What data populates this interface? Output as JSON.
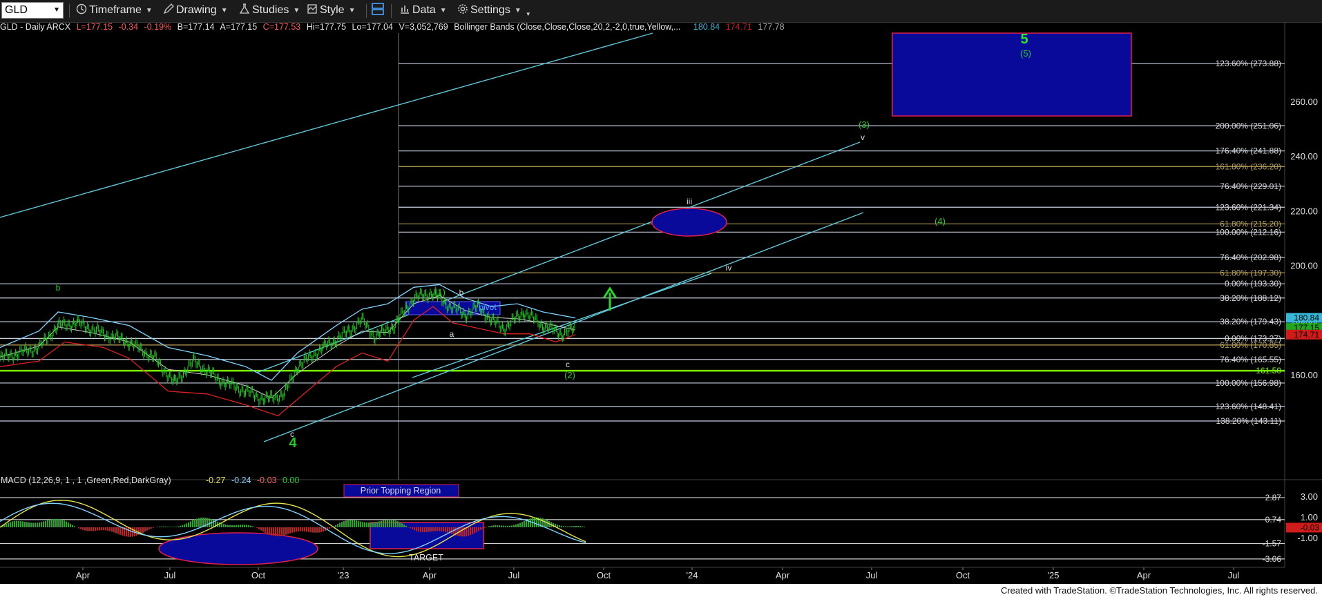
{
  "toolbar": {
    "symbol": "GLD",
    "timeframe_label": "Timeframe",
    "drawing_label": "Drawing",
    "studies_label": "Studies",
    "style_label": "Style",
    "data_label": "Data",
    "settings_label": "Settings"
  },
  "info": {
    "title": "GLD - Daily ARCX",
    "last": "L=177.15",
    "change": "-0.34",
    "pct": "-0.19%",
    "bid": "B=177.14",
    "ask": "A=177.15",
    "close": "C=177.53",
    "high": "Hi=177.75",
    "low": "Lo=177.04",
    "volume": "V=3,052,769",
    "study": "Bollinger Bands (Close,Close,Close,20,2,-2,0,true,Yellow,...",
    "bb_upper": "180.84",
    "bb_lower": "174.71",
    "bb_mid": "177.78"
  },
  "colors": {
    "price_bars": "#22cc22",
    "bb_upper": "#7fd3ff",
    "bb_lower": "#e02020",
    "bb_mid": "#cfcfcf",
    "trendline": "#5fc8d8",
    "fib_line": "#c8d0e0",
    "green_support": "#7cfc00",
    "box_blue": "#0a0a9a",
    "box_border": "#e0204a"
  },
  "chart_data": [
    {
      "type": "line",
      "title": "GLD - Daily ARCX",
      "ylim": [
        133,
        285
      ],
      "y_ticks": [
        160,
        180,
        200,
        220,
        240,
        260
      ],
      "x_labels": [
        "Apr",
        "Jul",
        "Oct",
        "'23",
        "Apr",
        "Jul",
        "Oct",
        "'24",
        "Apr",
        "Jul",
        "Oct",
        "'25",
        "Apr",
        "Jul"
      ],
      "right_price_tags": [
        {
          "value": 180.84,
          "label": "180.84",
          "color": "#39b7d6"
        },
        {
          "value": 177.15,
          "label": "177.15",
          "color": "#1fa81f"
        },
        {
          "value": 174.71,
          "label": "174.71",
          "color": "#d01b1b"
        }
      ],
      "series": [
        {
          "values_desc": "daily close",
          "points": [
            [
              0,
              166
            ],
            [
              0.03,
              170
            ],
            [
              0.045,
              178
            ],
            [
              0.06,
              179
            ],
            [
              0.08,
              175
            ],
            [
              0.1,
              172
            ],
            [
              0.12,
              166
            ],
            [
              0.135,
              157
            ],
            [
              0.15,
              165
            ],
            [
              0.17,
              158
            ],
            [
              0.19,
              154
            ],
            [
              0.205,
              151
            ],
            [
              0.22,
              153
            ],
            [
              0.23,
              163
            ],
            [
              0.25,
              170
            ],
            [
              0.27,
              176
            ],
            [
              0.28,
              180
            ],
            [
              0.29,
              174
            ],
            [
              0.305,
              178
            ],
            [
              0.32,
              188
            ],
            [
              0.335,
              190
            ],
            [
              0.345,
              186
            ],
            [
              0.36,
              182
            ],
            [
              0.37,
              185
            ],
            [
              0.38,
              180
            ],
            [
              0.39,
              177
            ],
            [
              0.405,
              183
            ],
            [
              0.42,
              178
            ],
            [
              0.435,
              175
            ],
            [
              0.445,
              177
            ]
          ]
        },
        {
          "name": "",
          "values_desc": "bb upper",
          "points": [
            [
              0,
              170
            ],
            [
              0.03,
              176
            ],
            [
              0.045,
              183
            ],
            [
              0.07,
              181
            ],
            [
              0.1,
              178
            ],
            [
              0.13,
              170
            ],
            [
              0.16,
              167
            ],
            [
              0.19,
              163
            ],
            [
              0.21,
              158
            ],
            [
              0.23,
              168
            ],
            [
              0.26,
              178
            ],
            [
              0.28,
              184
            ],
            [
              0.3,
              186
            ],
            [
              0.32,
              192
            ],
            [
              0.34,
              193
            ],
            [
              0.36,
              188
            ],
            [
              0.38,
              185
            ],
            [
              0.4,
              186
            ],
            [
              0.42,
              183
            ],
            [
              0.445,
              180.8
            ]
          ]
        },
        {
          "name": "",
          "values_desc": "bb lower",
          "points": [
            [
              0,
              163
            ],
            [
              0.03,
              165
            ],
            [
              0.05,
              172
            ],
            [
              0.08,
              170
            ],
            [
              0.1,
              166
            ],
            [
              0.13,
              154
            ],
            [
              0.16,
              153
            ],
            [
              0.19,
              149
            ],
            [
              0.215,
              145
            ],
            [
              0.235,
              153
            ],
            [
              0.26,
              163
            ],
            [
              0.28,
              168
            ],
            [
              0.3,
              165
            ],
            [
              0.32,
              180
            ],
            [
              0.335,
              185
            ],
            [
              0.35,
              179
            ],
            [
              0.37,
              177
            ],
            [
              0.39,
              175
            ],
            [
              0.41,
              175
            ],
            [
              0.43,
              172
            ],
            [
              0.445,
              174.7
            ]
          ]
        }
      ],
      "horizontal_levels": [
        {
          "label": "123.60% (273.88)",
          "value": 273.9
        },
        {
          "label": "200.00% (251.06)",
          "value": 251.1
        },
        {
          "label": "176.40% (241.88)",
          "value": 241.9
        },
        {
          "label": "161.80% (236.20)",
          "value": 236.2
        },
        {
          "label": "76.40% (229.01)",
          "value": 229.0
        },
        {
          "label": "123.60% (221.34)",
          "value": 221.3
        },
        {
          "label": "61.80% (215.20)",
          "value": 215.2
        },
        {
          "label": "100.00% (212.16)",
          "value": 212.2
        },
        {
          "label": "76.40% (202.98)",
          "value": 203.0
        },
        {
          "label": "61.80% (197.30)",
          "value": 197.3
        },
        {
          "label": "0.00% (193.30)",
          "value": 193.3
        },
        {
          "label": "38.20% (188.12)",
          "value": 188.1
        },
        {
          "label": "38.20% (179.43)",
          "value": 179.4
        },
        {
          "label": "0.00% (173.27)",
          "value": 173.3
        },
        {
          "label": "61.80% (170.85)",
          "value": 170.9
        },
        {
          "label": "76.40% (165.55)",
          "value": 165.6
        },
        {
          "label": "161.50",
          "value": 161.5
        },
        {
          "label": "100.00% (156.98)",
          "value": 157.0
        },
        {
          "label": "123.60% (148.41)",
          "value": 148.4
        },
        {
          "label": "138.20% (143.11)",
          "value": 143.1
        }
      ],
      "wave_labels": [
        {
          "text": "5",
          "x": "Dec '24",
          "y": 281
        },
        {
          "text": "(5)",
          "x": "Dec '24",
          "y": 277
        },
        {
          "text": "(3)",
          "x": "Jul '24",
          "y": 244
        },
        {
          "text": "v",
          "x": "Jul '24",
          "y": 240
        },
        {
          "text": "iii",
          "x": "Jan '24",
          "y": 222
        },
        {
          "text": "(4)",
          "x": "Aug '24",
          "y": 213
        },
        {
          "text": "iv",
          "x": "Feb '24",
          "y": 201
        },
        {
          "text": "b",
          "x": "Mar '22",
          "y": 193
        },
        {
          "text": "(1)",
          "x": "Apr '23",
          "y": 192
        },
        {
          "text": "b",
          "x": "May '23",
          "y": 192
        },
        {
          "text": "pivot",
          "x": "Jun '23",
          "y": 188
        },
        {
          "text": "a",
          "x": "May '23",
          "y": 177
        },
        {
          "text": "c",
          "x": "Sep '23",
          "y": 167
        },
        {
          "text": "(2)",
          "x": "Sep '23",
          "y": 165
        },
        {
          "text": "c",
          "x": "Nov '22",
          "y": 148
        },
        {
          "text": "4",
          "x": "Nov '22",
          "y": 144
        }
      ]
    },
    {
      "type": "line",
      "title": "MACD (12,26,9, 1 , 1 ,Green,Red,DarkGray)",
      "legend_values": [
        "-0.27",
        "-0.24",
        "-0.03",
        "0.00"
      ],
      "ylim": [
        -3.4,
        4.6
      ],
      "y_ticks": [
        3.0,
        1.0,
        -1.0
      ],
      "levels": [
        {
          "label": "2.87",
          "value": 2.87
        },
        {
          "label": "0.74",
          "value": 0.74
        },
        {
          "label": "-1.57",
          "value": -1.57
        },
        {
          "label": "-3.06",
          "value": -3.06
        }
      ],
      "right_tags": [
        {
          "label": "-0.03",
          "value": -0.03,
          "color": "#d01b1b"
        }
      ],
      "annotations": [
        "Prior Topping Region",
        "TARGET"
      ]
    }
  ],
  "footer": {
    "credit": "Created with TradeStation. ©TradeStation Technologies, Inc. All rights reserved."
  }
}
